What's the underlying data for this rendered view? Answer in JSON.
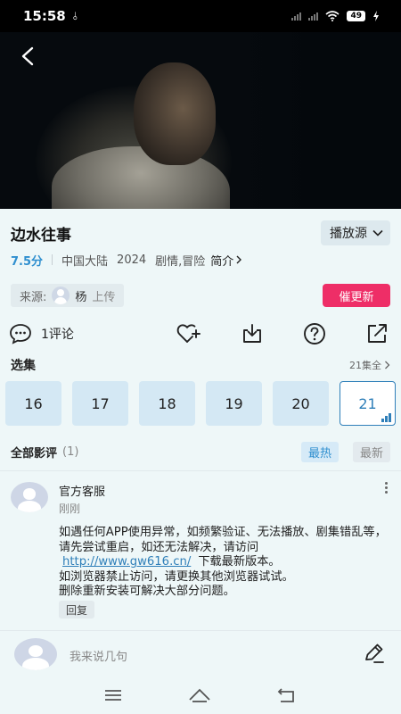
{
  "status_bar": {
    "time": "15:58",
    "usb_glyph": "⫰",
    "battery": "49"
  },
  "player": {
    "back_icon": "back-arrow-icon"
  },
  "show": {
    "title": "边水往事",
    "source_label": "播放源",
    "score": "7.5分",
    "region": "中国大陆",
    "year": "2024",
    "genres": "剧情,冒险",
    "intro_label": "简介"
  },
  "uploader": {
    "prefix": "来源:",
    "name": "杨",
    "action": "上传",
    "urge_label": "催更新"
  },
  "actions": {
    "comment_count_label": "1评论"
  },
  "episodes": {
    "label": "选集",
    "total_label": "21集全",
    "items": [
      "16",
      "17",
      "18",
      "19",
      "20",
      "21"
    ],
    "current": "21"
  },
  "reviews": {
    "label": "全部影评",
    "count": "(1)",
    "sort_hot": "最热",
    "sort_new": "最新"
  },
  "comment": {
    "author": "官方客服",
    "time": "刚刚",
    "line1": "如遇任何APP使用异常，如频繁验证、无法播放、剧集错乱等，请先尝试重启，如还无法解决，请访问",
    "link": "http://www.gw616.cn/",
    "line2": "下载最新版本。",
    "line3": "如浏览器禁止访问，请更换其他浏览器试试。",
    "line4": "删除重新安装可解决大部分问题。",
    "reply_label": "回复"
  },
  "input": {
    "placeholder": "我来说几句"
  },
  "colors": {
    "accent": "#2f8fcf",
    "urge": "#ee2e67",
    "page_bg": "#eef7f8"
  }
}
